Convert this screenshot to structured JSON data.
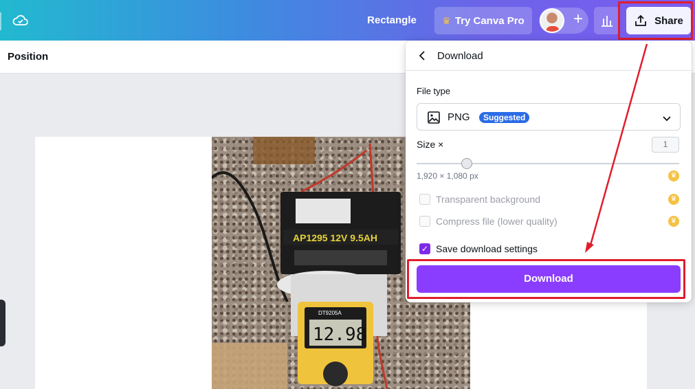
{
  "topbar": {
    "title": "Rectangle",
    "pro_label": "Try Canva Pro",
    "share_label": "Share"
  },
  "subbar": {
    "position_label": "Position"
  },
  "panel": {
    "title": "Download",
    "file_type_label": "File type",
    "file_type_value": "PNG",
    "suggested_badge": "Suggested",
    "size_label": "Size ×",
    "size_value": "1",
    "dimensions": "1,920 × 1,080 px",
    "options": [
      {
        "label": "Transparent background",
        "checked": false,
        "disabled": true
      },
      {
        "label": "Compress file (lower quality)",
        "checked": false,
        "disabled": true
      },
      {
        "label": "Save download settings",
        "checked": true,
        "disabled": false
      }
    ],
    "download_label": "Download"
  },
  "photo": {
    "battery_line1": "AP1295 12V 9.5AH",
    "meter_reading": "12.98",
    "meter_model": "DT9205A"
  },
  "colors": {
    "accent": "#8b3dff",
    "highlight": "#e11d2b",
    "badge": "#2b6be6"
  }
}
